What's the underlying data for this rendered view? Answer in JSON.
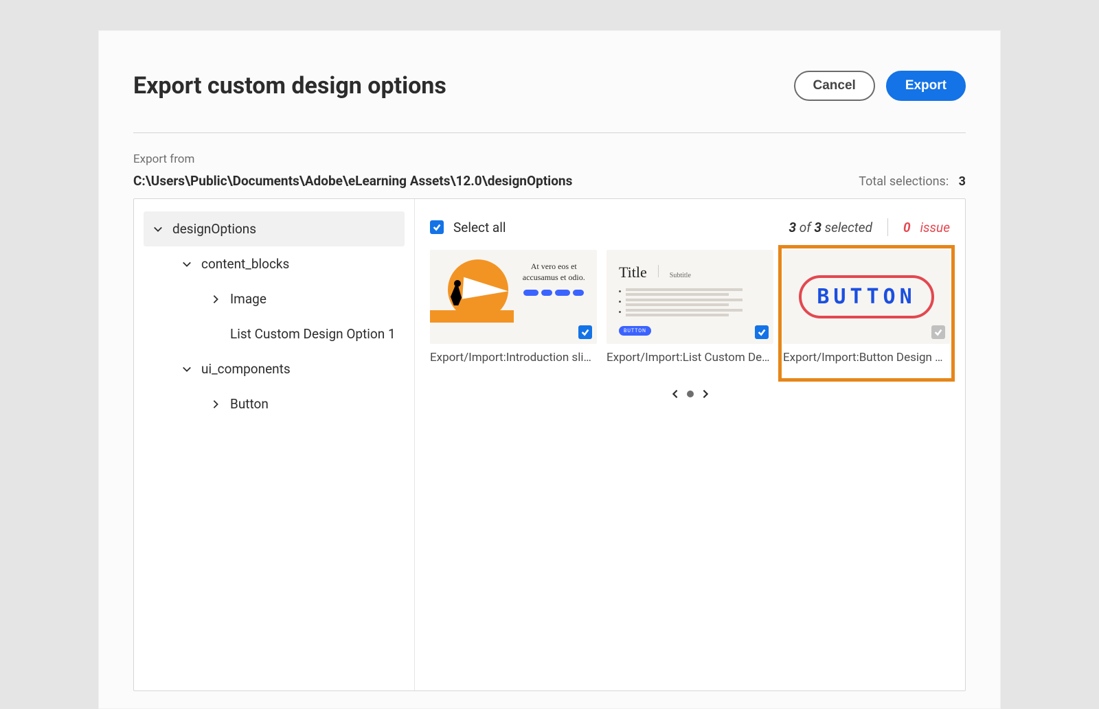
{
  "header": {
    "title": "Export custom design options",
    "cancel": "Cancel",
    "export": "Export"
  },
  "exportFrom": {
    "label": "Export from",
    "path": "C:\\Users\\Public\\Documents\\Adobe\\eLearning Assets\\12.0\\designOptions"
  },
  "totals": {
    "label": "Total selections:",
    "count": "3"
  },
  "tree": [
    {
      "label": "designOptions",
      "level": 0,
      "expand": "down",
      "selected": true
    },
    {
      "label": "content_blocks",
      "level": 1,
      "expand": "down"
    },
    {
      "label": "Image",
      "level": 2,
      "expand": "right"
    },
    {
      "label": "List Custom Design Option 1",
      "level": 2,
      "expand": "none"
    },
    {
      "label": "ui_components",
      "level": 1,
      "expand": "down"
    },
    {
      "label": "Button",
      "level": 2,
      "expand": "right"
    }
  ],
  "content": {
    "selectAll": "Select all",
    "selectedCount": "3",
    "selectedOf": "of",
    "selectedTotal": "3",
    "selectedWord": "selected",
    "issueCount": "0",
    "issueWord": "issue",
    "items": [
      {
        "label": "Export/Import:Introduction slid…",
        "chk": "checked",
        "thumbText": "At vero eos et accusamus et odio."
      },
      {
        "label": "Export/Import:List Custom Desi…",
        "chk": "checked",
        "thumbTitle": "Title",
        "thumbSub": "Subtitle",
        "thumbBtn": "BUTTON"
      },
      {
        "label": "Export/Import:Button Design O…",
        "chk": "muted",
        "thumbBtn": "BUTTON",
        "highlight": true
      }
    ]
  }
}
